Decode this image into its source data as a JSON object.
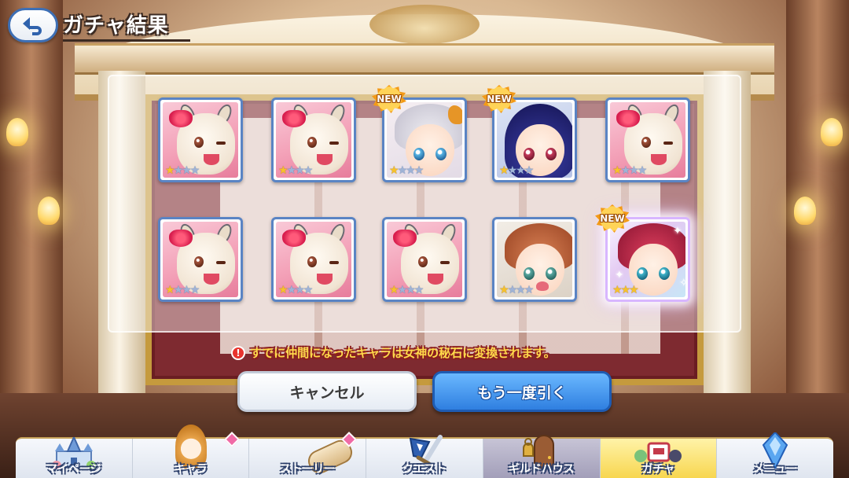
{
  "header": {
    "title": "ガチャ結果"
  },
  "cards": [
    {
      "type": "alpaca",
      "stars": 1,
      "max": 4,
      "new": false
    },
    {
      "type": "alpaca",
      "stars": 1,
      "max": 4,
      "new": false
    },
    {
      "type": "silver",
      "stars": 1,
      "max": 4,
      "new": true
    },
    {
      "type": "navy",
      "stars": 1,
      "max": 4,
      "new": true
    },
    {
      "type": "alpaca",
      "stars": 1,
      "max": 4,
      "new": false
    },
    {
      "type": "alpaca",
      "stars": 1,
      "max": 4,
      "new": false
    },
    {
      "type": "alpaca",
      "stars": 1,
      "max": 4,
      "new": false
    },
    {
      "type": "alpaca",
      "stars": 1,
      "max": 4,
      "new": false
    },
    {
      "type": "brown",
      "stars": 1,
      "max": 4,
      "new": false
    },
    {
      "type": "red",
      "stars": 3,
      "max": 3,
      "new": true
    }
  ],
  "badge_label": "NEW",
  "notice": {
    "icon": "!",
    "text": "すでに仲間になったキャラは女神の秘石に変換されます。"
  },
  "buttons": {
    "cancel": "キャンセル",
    "again": "もう一度引く"
  },
  "nav": [
    {
      "id": "mypage",
      "label": "マイページ",
      "icon": "castle-icon",
      "dot": false
    },
    {
      "id": "chara",
      "label": "キャラ",
      "icon": "character-icon",
      "dot": true
    },
    {
      "id": "story",
      "label": "ストーリー",
      "icon": "scroll-icon",
      "dot": true
    },
    {
      "id": "quest",
      "label": "クエスト",
      "icon": "sword-icon",
      "dot": false
    },
    {
      "id": "guild",
      "label": "ギルドハウス",
      "icon": "door-icon",
      "dot": false
    },
    {
      "id": "gacha",
      "label": "ガチャ",
      "icon": "gacha-icon",
      "dot": false,
      "active": true
    },
    {
      "id": "menu",
      "label": "メニュー",
      "icon": "crystal-icon",
      "dot": false
    }
  ]
}
